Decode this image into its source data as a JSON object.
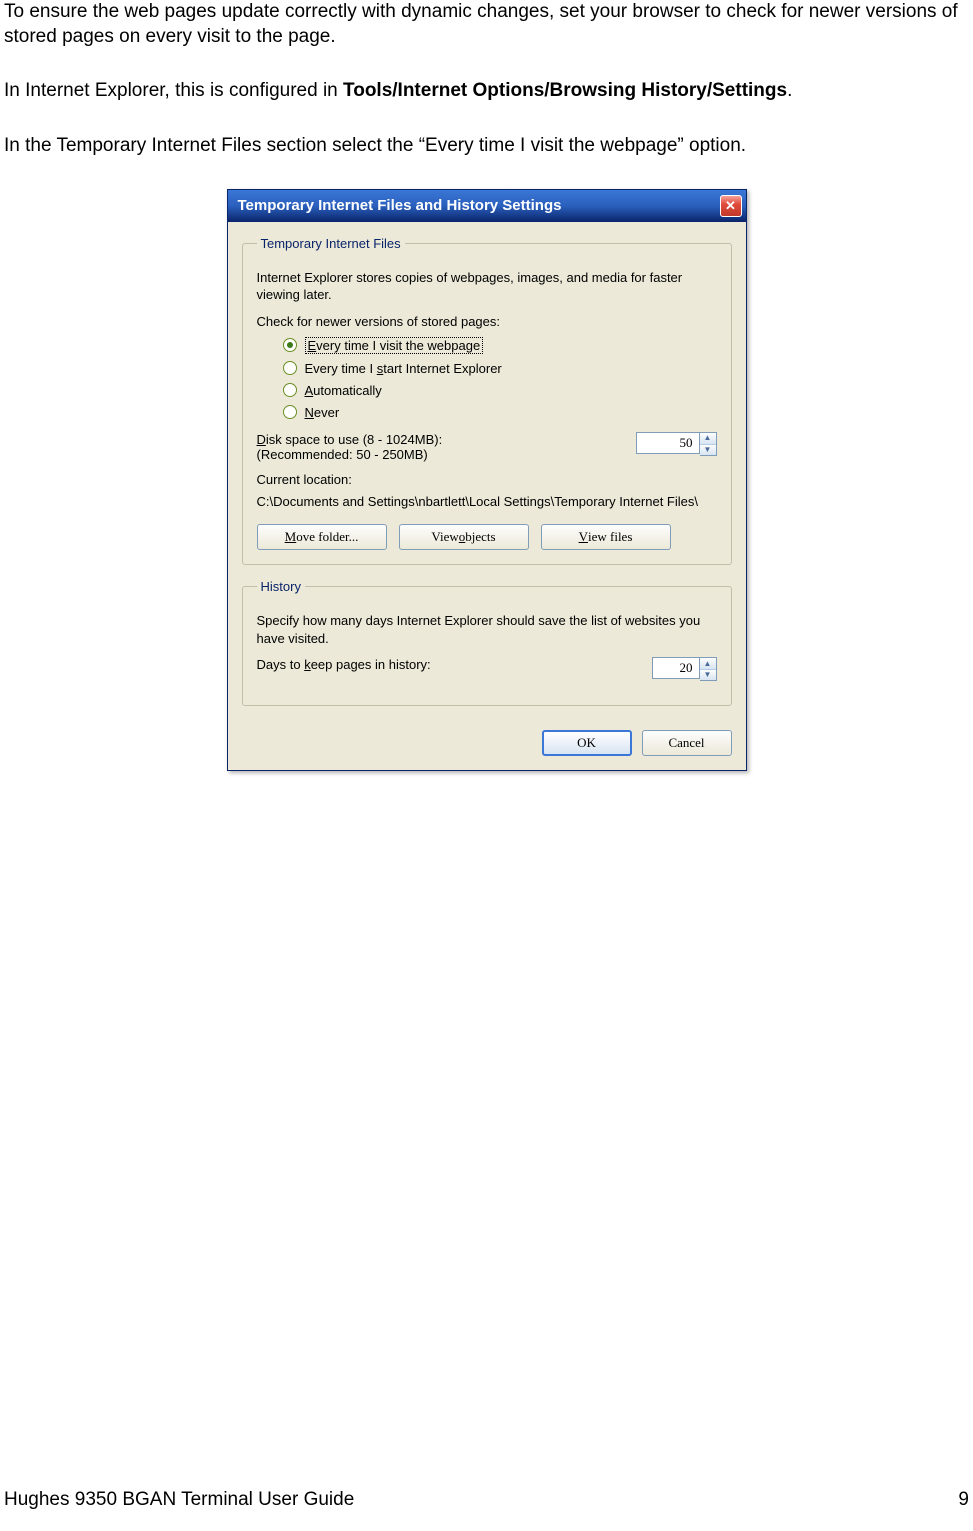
{
  "page": {
    "p1": "To ensure the web pages update correctly with dynamic changes, set your browser to check for newer versions of stored pages on every visit to the page.",
    "p2_prefix": "In Internet Explorer, this is configured in ",
    "p2_bold": "Tools/Internet Options/Browsing History/Settings",
    "p2_suffix": ".",
    "p3": "In the Temporary Internet Files section select the “Every time I visit the webpage” option."
  },
  "dialog": {
    "title": "Temporary Internet Files and History Settings",
    "close_glyph": "✕",
    "temp_files": {
      "legend": "Temporary Internet Files",
      "desc": "Internet Explorer stores copies of webpages, images, and media for faster viewing later.",
      "check_label": "Check for newer versions of stored pages:",
      "radios": {
        "r1_pre": "E",
        "r1_rest": "very time I visit the webpage",
        "r2_a": "Every time I ",
        "r2_u": "s",
        "r2_b": "tart Internet Explorer",
        "r3_u": "A",
        "r3_rest": "utomatically",
        "r4_u": "N",
        "r4_rest": "ever"
      },
      "disk_label_a": "D",
      "disk_label_b": "isk space to use (8 - 1024MB):",
      "disk_rec": "(Recommended: 50 - 250MB)",
      "disk_value": "50",
      "loc_label": "Current location:",
      "loc_path": "C:\\Documents and Settings\\nbartlett\\Local Settings\\Temporary Internet Files\\",
      "btn_move_a": "M",
      "btn_move_b": "ove folder...",
      "btn_view_obj_a": "View ",
      "btn_view_obj_u": "o",
      "btn_view_obj_b": "bjects",
      "btn_view_files_a": "V",
      "btn_view_files_b": "iew files"
    },
    "history": {
      "legend": "History",
      "desc": "Specify how many days Internet Explorer should save the list of websites you have visited.",
      "days_label_a": "Days to ",
      "days_label_u": "k",
      "days_label_b": "eep pages in history:",
      "days_value": "20"
    },
    "ok": "OK",
    "cancel": "Cancel"
  },
  "footer": {
    "left": "Hughes 9350 BGAN Terminal User Guide",
    "right": "9"
  }
}
